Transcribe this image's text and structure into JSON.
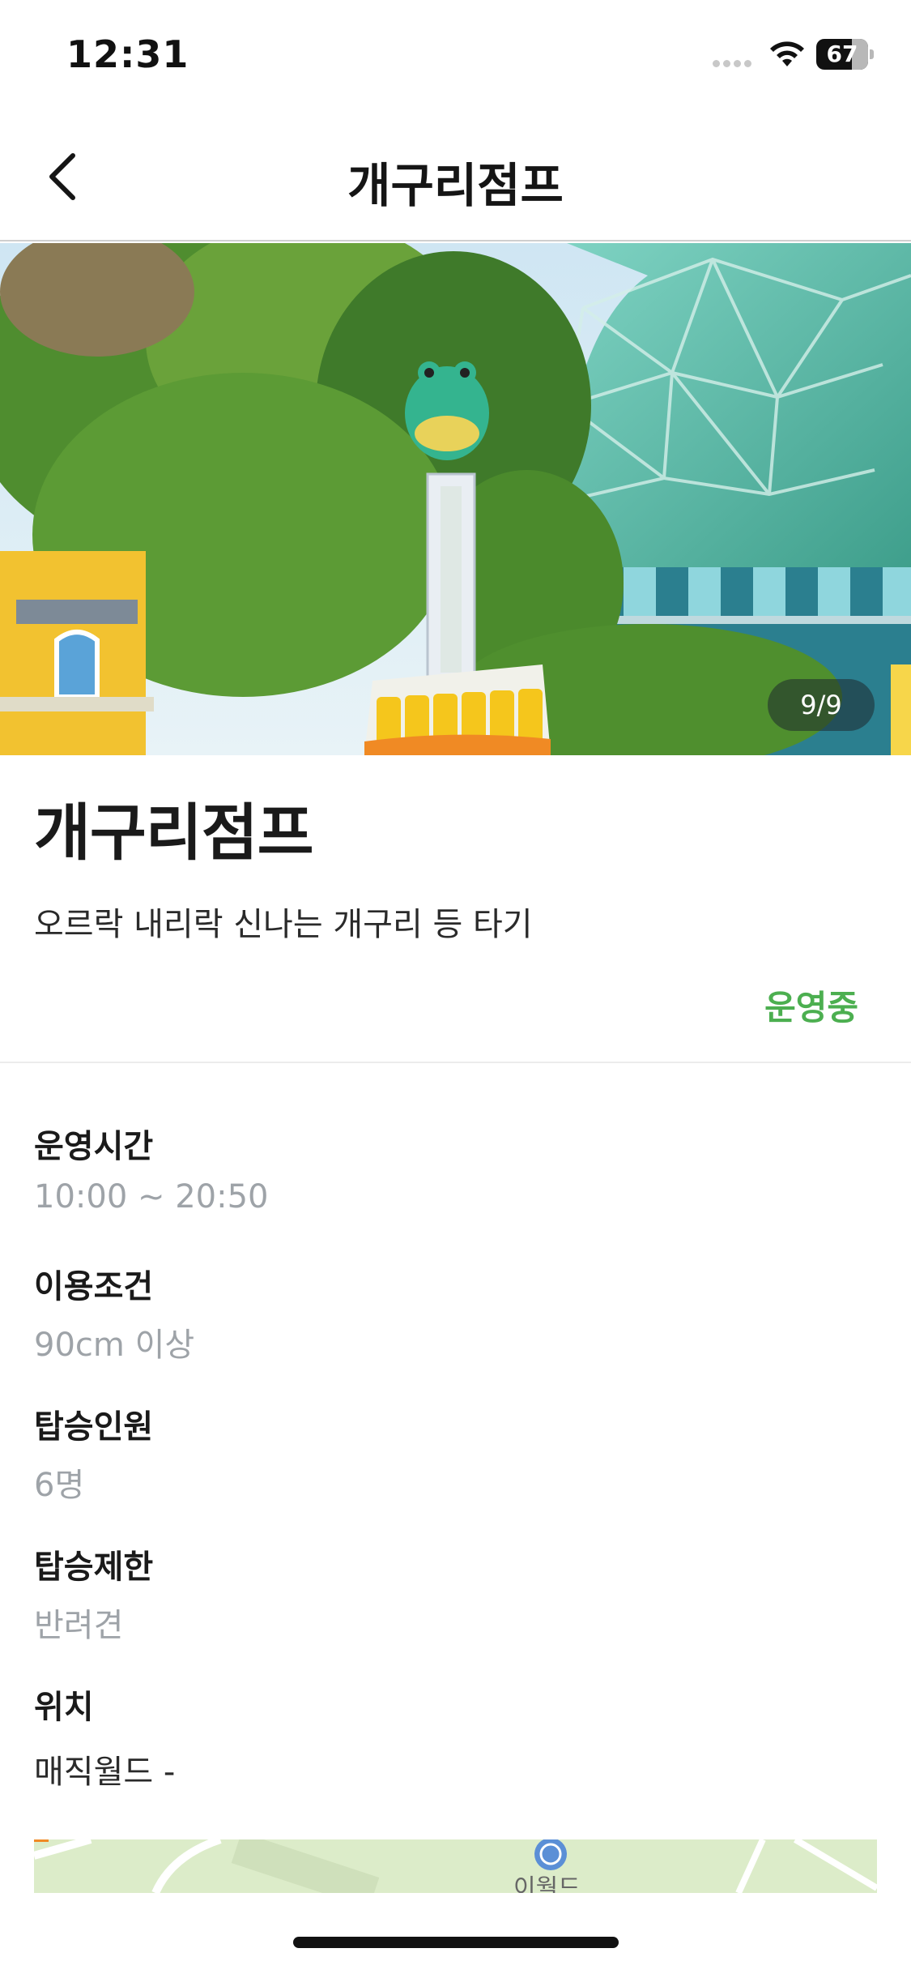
{
  "status_bar": {
    "time": "12:31",
    "battery_level": "67",
    "icons": [
      "signal-icon",
      "wifi-icon",
      "battery-icon"
    ]
  },
  "nav": {
    "back_icon": "chevron-left-icon",
    "title": "개구리점프"
  },
  "hero": {
    "photo_counter": "9/9"
  },
  "ride": {
    "title": "개구리점프",
    "description": "오르락 내리락 신나는 개구리 등 타기",
    "status": "운영중"
  },
  "info": {
    "hours": {
      "label": "운영시간",
      "value": "10:00 ~ 20:50"
    },
    "requirement": {
      "label": "이용조건",
      "value": "90cm 이상"
    },
    "capacity": {
      "label": "탑승인원",
      "value": "6명"
    },
    "restriction": {
      "label": "탑승제한",
      "value": "반려견"
    },
    "location": {
      "label": "위치",
      "value": "매직월드 -"
    }
  },
  "map": {
    "partial_label": "이월드"
  },
  "colors": {
    "accent_green": "#4caf50",
    "muted_text": "#9ea3a8",
    "divider": "#ececec"
  }
}
